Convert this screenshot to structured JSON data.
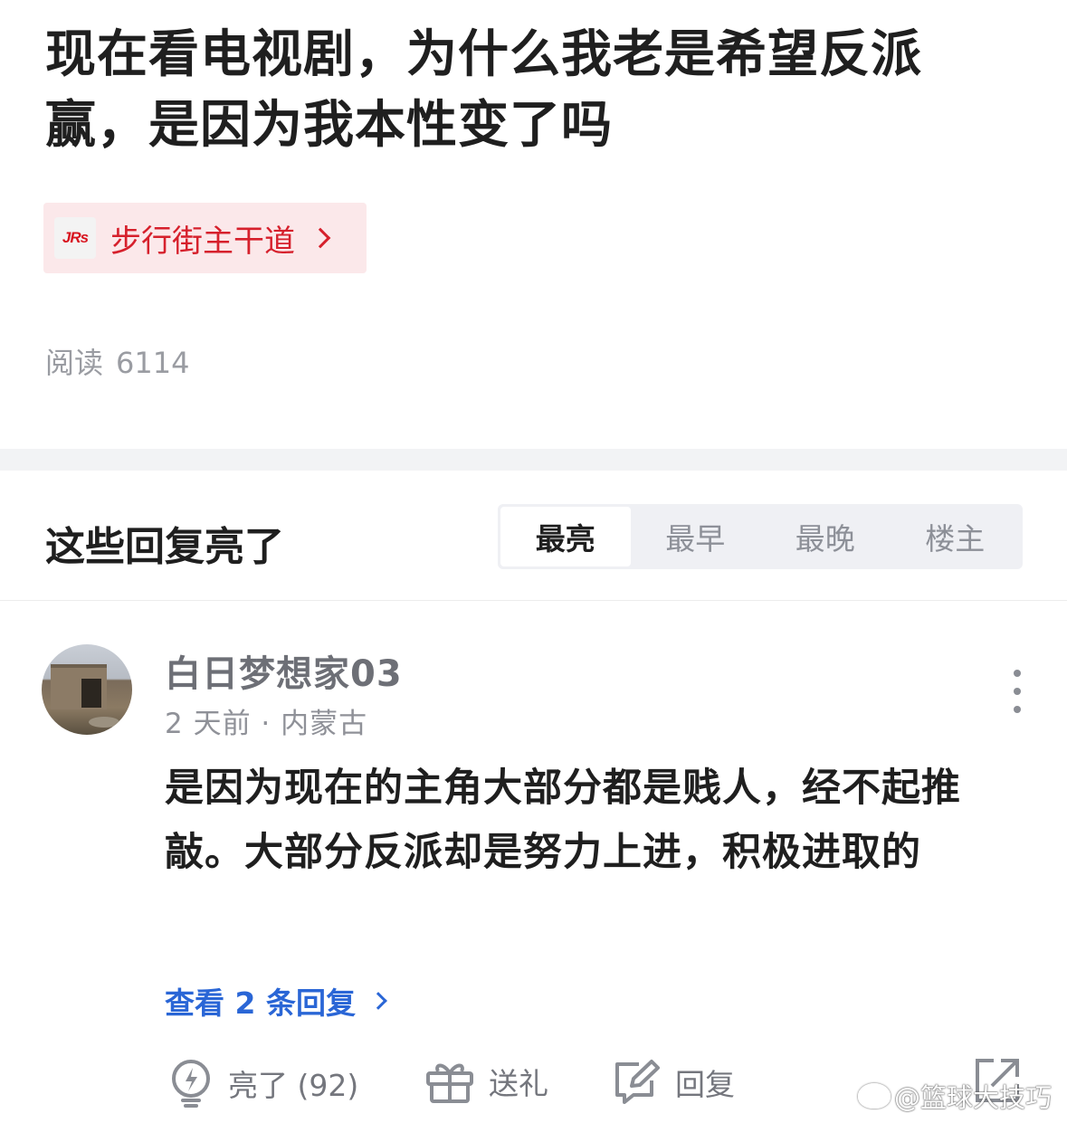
{
  "post": {
    "title": "现在看电视剧，为什么我老是希望反派赢，是因为我本性变了吗",
    "board": {
      "logo_text": "JRs",
      "name": "步行街主干道"
    },
    "read_label": "阅读",
    "read_count": "6114"
  },
  "replies": {
    "section_title": "这些回复亮了",
    "sort_tabs": [
      {
        "label": "最亮",
        "active": true
      },
      {
        "label": "最早",
        "active": false
      },
      {
        "label": "最晚",
        "active": false
      },
      {
        "label": "楼主",
        "active": false
      }
    ]
  },
  "comment": {
    "user_name": "白日梦想家03",
    "meta": "2 天前 · 内蒙古",
    "body": "是因为现在的主角大部分都是贱人，经不起推敲。大部分反派却是努力上进，积极进取的",
    "view_replies": "查看 2 条回复",
    "actions": {
      "like": "亮了 (92)",
      "gift": "送礼",
      "reply": "回复"
    }
  },
  "watermark": "@篮球大技巧",
  "colors": {
    "accent_red": "#d6202c",
    "link_blue": "#2a66d6",
    "chip_bg": "#fbe8ea",
    "divider": "#f2f3f5"
  },
  "icons": [
    "chevron-right-icon",
    "more-vertical-icon",
    "lightbulb-icon",
    "gift-icon",
    "edit-reply-icon",
    "share-icon",
    "weibo-icon"
  ]
}
